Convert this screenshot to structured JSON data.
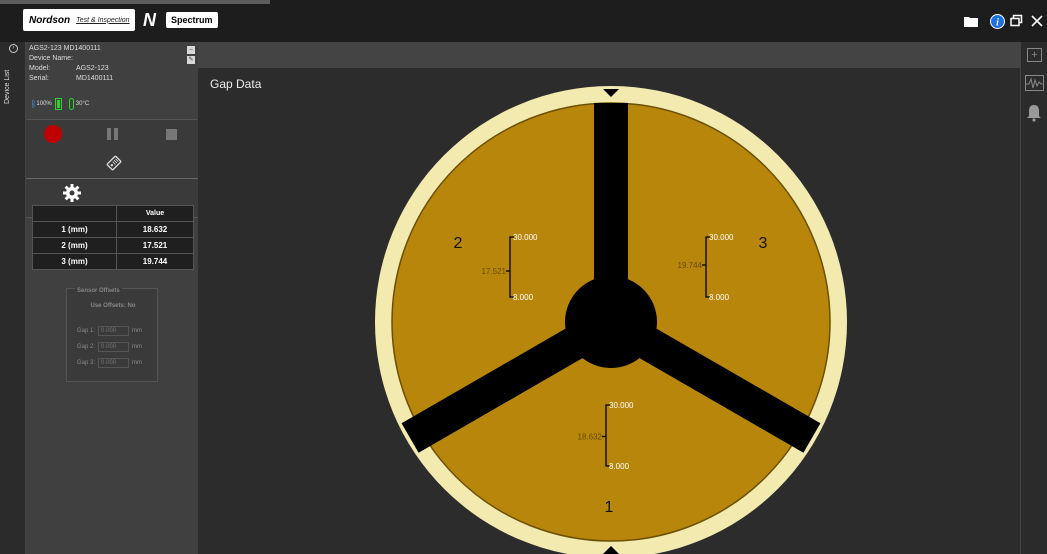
{
  "topbar": {
    "brand": "Nordson",
    "brand_sub": "Test & Inspection",
    "product_mark": "N",
    "product": "Spectrum"
  },
  "device_list_label": "Device List",
  "device": {
    "header": "AGS2-123 MD1400111",
    "name_label": "Device Name:",
    "name_value": "",
    "model_label": "Model:",
    "model_value": "AGS2-123",
    "serial_label": "Serial:",
    "serial_value": "MD1400111",
    "battery": "100%",
    "temperature": "30°C"
  },
  "table": {
    "header_label": "",
    "header_value": "Value",
    "rows": [
      {
        "label": "1 (mm)",
        "value": "18.632"
      },
      {
        "label": "2 (mm)",
        "value": "17.521"
      },
      {
        "label": "3 (mm)",
        "value": "19.744"
      }
    ]
  },
  "offsets": {
    "legend": "Sensor Offsets",
    "use_offsets": "Use Offsets: No",
    "gaps": [
      {
        "label": "Gap 1:",
        "value": "0.000",
        "unit": "mm"
      },
      {
        "label": "Gap 2:",
        "value": "0.000",
        "unit": "mm"
      },
      {
        "label": "Gap 3:",
        "value": "0.000",
        "unit": "mm"
      }
    ]
  },
  "main": {
    "title": "Gap Data"
  },
  "gauge": {
    "colors": {
      "ring": "#f3eaaf",
      "fill": "#b8860b",
      "spoke": "#000000",
      "scale_text": "#ffffff",
      "value_text": "#6b4a00"
    },
    "sensors": [
      {
        "id": "1",
        "value": 18.632,
        "value_label": "18.632",
        "max_label": "30.000",
        "min_label": "8.000",
        "max": 30,
        "min": 8
      },
      {
        "id": "2",
        "value": 17.521,
        "value_label": "17.521",
        "max_label": "30.000",
        "min_label": "8.000",
        "max": 30,
        "min": 8
      },
      {
        "id": "3",
        "value": 19.744,
        "value_label": "19.744",
        "max_label": "30.000",
        "min_label": "8.000",
        "max": 30,
        "min": 8
      }
    ]
  },
  "icons": [
    "folder-icon",
    "info-icon",
    "restore-window-icon",
    "close-icon",
    "add-panel-icon",
    "waveform-icon",
    "bell-icon",
    "gear-icon",
    "tag-icon",
    "bluetooth-icon",
    "battery-icon",
    "thermometer-icon"
  ]
}
